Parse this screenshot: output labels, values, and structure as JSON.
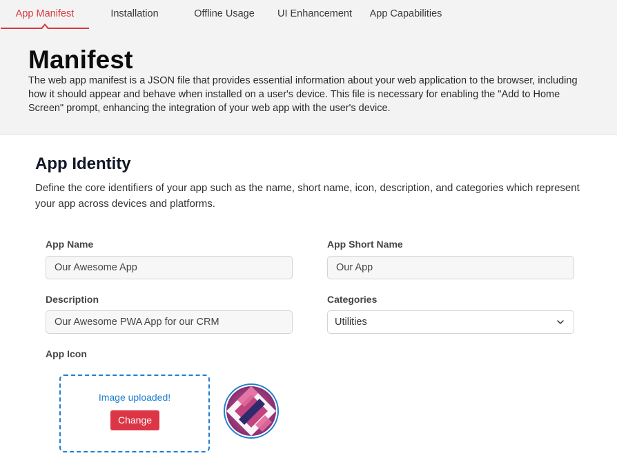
{
  "tabs": [
    {
      "label": "App Manifest",
      "active": true
    },
    {
      "label": "Installation",
      "active": false
    },
    {
      "label": "Offline Usage",
      "active": false
    },
    {
      "label": "UI Enhancement",
      "active": false
    },
    {
      "label": "App Capabilities",
      "active": false
    }
  ],
  "hero": {
    "title": "Manifest",
    "description": "The web app manifest is a JSON file that provides essential information about your web application to the browser, including how it should appear and behave when installed on a user's device. This file is necessary for enabling the \"Add to Home Screen\" prompt, enhancing the integration of your web app with the user's device."
  },
  "section": {
    "title": "App Identity",
    "description": "Define the core identifiers of your app such as the name, short name, icon, description, and categories which represent your app across devices and platforms."
  },
  "form": {
    "app_name": {
      "label": "App Name",
      "value": "Our Awesome App"
    },
    "app_short_name": {
      "label": "App Short Name",
      "value": "Our App"
    },
    "description": {
      "label": "Description",
      "value": "Our Awesome PWA App for our CRM"
    },
    "categories": {
      "label": "Categories",
      "value": "Utilities"
    },
    "app_icon": {
      "label": "App Icon",
      "status": "Image uploaded!",
      "change_label": "Change"
    }
  },
  "colors": {
    "accent": "#d73a3f",
    "link_blue": "#1f7ed0",
    "button_red": "#dc3545"
  },
  "icons": {
    "chevron": "chevron-down-icon",
    "app_icon": "app-icon-preview"
  }
}
